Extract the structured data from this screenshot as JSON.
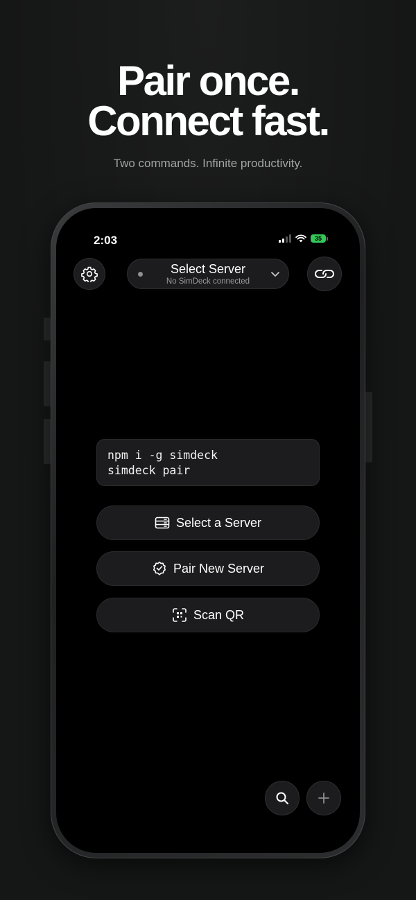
{
  "hero": {
    "line1": "Pair once.",
    "line2": "Connect fast.",
    "subtitle": "Two commands. Infinite productivity."
  },
  "status_bar": {
    "time": "2:03",
    "battery": "35"
  },
  "header": {
    "server_title": "Select Server",
    "server_subtitle": "No SimDeck connected"
  },
  "code": {
    "line1": "npm i -g simdeck",
    "line2": "simdeck pair"
  },
  "actions": {
    "select_server": "Select a Server",
    "pair_new": "Pair New Server",
    "scan_qr": "Scan QR"
  }
}
